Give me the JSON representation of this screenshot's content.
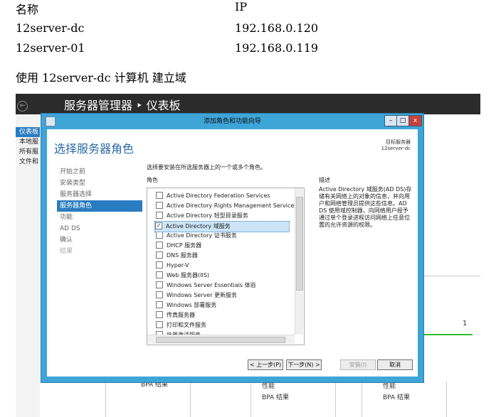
{
  "doc": {
    "table_headers": [
      "名称",
      "IP"
    ],
    "rows": [
      {
        "name": "12server-dc",
        "ip": "192.168.0.120"
      },
      {
        "name": "12server-01",
        "ip": "192.168.0.119"
      }
    ],
    "caption": "使用 12server-dc 计算机 建立域"
  },
  "server_manager": {
    "title": "服务器管理器 ‣ 仪表板",
    "left_items": [
      "仪表板",
      "本地服",
      "所有服",
      "文件和"
    ],
    "panel_value": "1",
    "panel_labels": [
      "BPA 结果",
      "性能",
      "BPA 结果",
      "性能",
      "BPA 结果"
    ]
  },
  "wizard": {
    "title": "添加角色和功能向导",
    "heading": "选择服务器角色",
    "target_label": "目标服务器",
    "target_server": "12server-dc",
    "steps": [
      {
        "label": "开始之前",
        "state": "normal"
      },
      {
        "label": "安装类型",
        "state": "normal"
      },
      {
        "label": "服务器选择",
        "state": "normal"
      },
      {
        "label": "服务器角色",
        "state": "active"
      },
      {
        "label": "功能",
        "state": "normal"
      },
      {
        "label": "AD DS",
        "state": "normal"
      },
      {
        "label": "确认",
        "state": "normal"
      },
      {
        "label": "结果",
        "state": "dim"
      }
    ],
    "instruction": "选择要安装在所选服务器上的一个或多个角色。",
    "roles_header": "角色",
    "desc_header": "描述",
    "roles": [
      {
        "label": "Active Directory Federation Services",
        "checked": false,
        "selected": false
      },
      {
        "label": "Active Directory Rights Management Services",
        "checked": false,
        "selected": false
      },
      {
        "label": "Active Directory 轻型目录服务",
        "checked": false,
        "selected": false
      },
      {
        "label": "Active Directory 域服务",
        "checked": true,
        "selected": true
      },
      {
        "label": "Active Directory 证书服务",
        "checked": false,
        "selected": false
      },
      {
        "label": "DHCP 服务器",
        "checked": false,
        "selected": false
      },
      {
        "label": "DNS 服务器",
        "checked": false,
        "selected": false
      },
      {
        "label": "Hyper-V",
        "checked": false,
        "selected": false
      },
      {
        "label": "Web 服务器(IIS)",
        "checked": false,
        "selected": false
      },
      {
        "label": "Windows Server Essentials 体验",
        "checked": false,
        "selected": false
      },
      {
        "label": "Windows Server 更新服务",
        "checked": false,
        "selected": false
      },
      {
        "label": "Windows 部署服务",
        "checked": false,
        "selected": false
      },
      {
        "label": "传真服务器",
        "checked": false,
        "selected": false
      },
      {
        "label": "打印和文件服务",
        "checked": false,
        "selected": false
      },
      {
        "label": "批量激活服务",
        "checked": false,
        "selected": false
      }
    ],
    "description": "Active Directory 域服务(AD DS)存储有关网络上的对象的信息，并向用户和网络管理员提供这些信息。AD DS 使用域控制器，向网络用户授予通过单个登录进程访问网络上任意位置的允许资源的权限。",
    "buttons": {
      "prev": "< 上一步(P)",
      "next": "下一步(N) >",
      "install": "安装(I)",
      "cancel": "取消"
    },
    "window_buttons": {
      "minimize": "–",
      "maximize": "□",
      "close": "x"
    }
  }
}
